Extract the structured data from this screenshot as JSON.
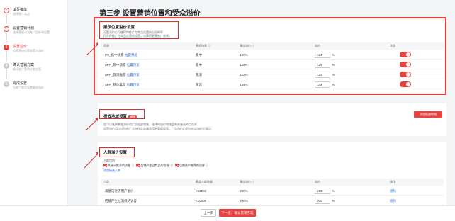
{
  "sidebar": {
    "steps": [
      {
        "num": "✓",
        "title": "填写推单",
        "sub": "选择推广商品",
        "state": "done"
      },
      {
        "num": "✓",
        "title": "设置营销计划",
        "sub": "选择营销计划推广目标和设置",
        "state": "done"
      },
      {
        "num": "3",
        "title": "设置溢价",
        "sub": "设置营销位置和受众溢价",
        "state": "active"
      },
      {
        "num": "4",
        "title": "确认营销方案",
        "sub": "确认推广营销计划方案",
        "state": "todo"
      },
      {
        "num": "5",
        "title": "完成设置",
        "sub": "为每个商品设置最终溢价",
        "state": "todo"
      }
    ]
  },
  "page": {
    "title": "第三步 设置营销位置和受众溢价"
  },
  "placement": {
    "title": "展示位置溢价设置",
    "desc1": "设置溢价后可使得你推广在商品位置的出现概率",
    "desc2": "打开你推广在商品位置的设置，以获得更高推广效果。",
    "headers": [
      "资源",
      "营销场景 ⓘ",
      "建议溢价 ⓘ",
      "溢价",
      "状态"
    ],
    "rows": [
      {
        "name": "PC_焦中场景",
        "link": "位置预览",
        "scene": "焦中",
        "suggest": "130%",
        "value": "134",
        "unit": "%"
      },
      {
        "name": "APP_焦中场景",
        "link": "位置预览",
        "scene": "焦中",
        "suggest": "125%",
        "value": "125",
        "unit": "%"
      },
      {
        "name": "APP_我浏推荐",
        "link": "位置预览",
        "scene": "我浏",
        "suggest": "122%",
        "value": "123",
        "unit": "%"
      },
      {
        "name": "APP_猜你喜欢",
        "link": "位置预览",
        "scene": "猜您",
        "suggest": "144%",
        "value": "144",
        "unit": "%"
      }
    ]
  },
  "geo": {
    "title": "投放地域设置",
    "badge": "NEW",
    "desc1": "您可以选择需要溢价的广告投放地域，选择的溢价地域会带来更高的点击率",
    "desc2": "设置溢价可以让您的广告在指定地域获得更高展现率，广告溢价后的出价以溢价后展示",
    "button": "添加投放地域"
  },
  "crowd": {
    "title": "人群溢价设置",
    "sub": "人群包内",
    "options": [
      "关键词推荐的访客 ⓘ",
      "店铺产生过商品的访客 ⓘ",
      "店铺选中推荐的访客 ⓘ"
    ],
    "add_link": "添加精选人群",
    "headers": [
      "人群",
      "覆盖人群数量",
      "建议溢价 ⓘ",
      "溢价",
      "操作"
    ],
    "rows": [
      {
        "name": "高意向进店用户溢价",
        "count": "<10000",
        "suggest": "200%",
        "value": "200",
        "unit": "%",
        "op": "删除"
      },
      {
        "name": "店铺产生过消费的访客",
        "count": "<10000",
        "suggest": "200%",
        "value": "200",
        "unit": "%",
        "op": "删除"
      }
    ]
  },
  "footer": {
    "prev": "上一步",
    "next": "下一步，确认营销方案"
  },
  "colors": {
    "accent": "#e8423f",
    "link": "#2f6fd6"
  }
}
